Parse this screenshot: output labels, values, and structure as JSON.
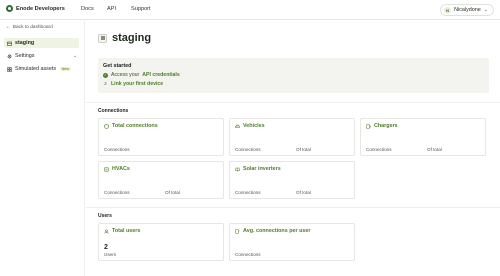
{
  "header": {
    "brand": "Enode Developers",
    "nav": [
      "Docs",
      "API",
      "Support"
    ],
    "user_initial": "N",
    "user_name": "Nicalydone"
  },
  "sidebar": {
    "back_label": "Back to dashboard",
    "items": [
      {
        "label": "staging",
        "active": true
      },
      {
        "label": "Settings"
      },
      {
        "label": "Simulated assets",
        "badge": "New"
      }
    ]
  },
  "page": {
    "title": "staging"
  },
  "get_started": {
    "title": "Get started",
    "step1_prefix": "Access your",
    "step1_link": "API credentials",
    "step2_number": "2",
    "step2_link": "Link your first device"
  },
  "connections": {
    "label": "Connections",
    "cards": [
      {
        "title": "Total connections",
        "foot_left": "Connections",
        "foot_right": ""
      },
      {
        "title": "Vehicles",
        "foot_left": "Connections",
        "foot_right": "Of total"
      },
      {
        "title": "Chargers",
        "foot_left": "Connections",
        "foot_right": "Of total"
      },
      {
        "title": "HVACs",
        "foot_left": "Connections",
        "foot_right": "Of total"
      },
      {
        "title": "Solar inverters",
        "foot_left": "Connections",
        "foot_right": "Of total"
      }
    ]
  },
  "users": {
    "label": "Users",
    "cards": [
      {
        "title": "Total users",
        "value": "2",
        "foot_left": "Users"
      },
      {
        "title": "Avg. connections per user",
        "value": "",
        "foot_left": "Connections"
      }
    ]
  },
  "colors": {
    "accent": "#4e7d27",
    "brand": "#2f6b2f",
    "active_bg": "#eef3e2",
    "panel_bg": "#f3f3ef"
  }
}
